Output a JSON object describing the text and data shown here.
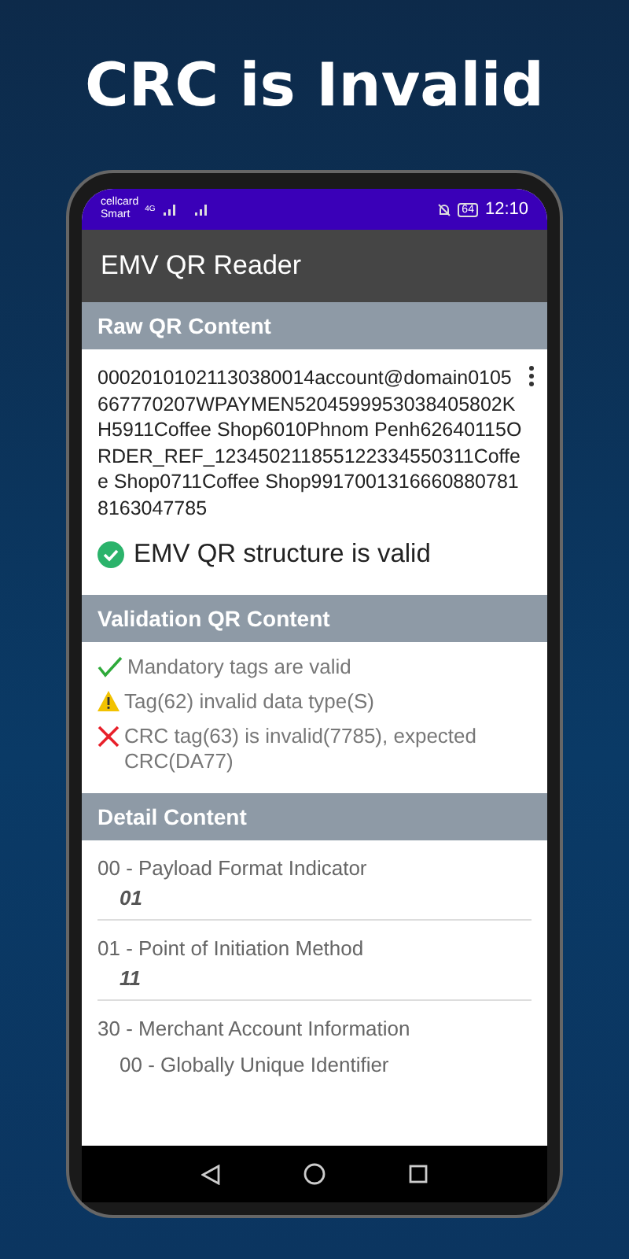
{
  "headline": "CRC is Invalid",
  "status_bar": {
    "carrier": "cellcard",
    "carrier_sub": "Smart",
    "network": "4G",
    "battery": "64",
    "time": "12:10"
  },
  "app_bar": {
    "title": "EMV QR Reader"
  },
  "raw_section": {
    "title": "Raw QR Content",
    "content": "00020101021130380014account@domain0105667770207WPAYMEN5204599953038405802KH5911Coffee Shop6010Phnom Penh62640115ORDER_REF_123450211855122334550311Coffee Shop0711Coffee Shop99170013166608807818163047785",
    "status": "EMV QR structure is valid"
  },
  "validation_section": {
    "title": "Validation QR Content",
    "items": [
      {
        "kind": "ok",
        "text": "Mandatory tags are valid"
      },
      {
        "kind": "warning",
        "text": "Tag(62) invalid data type(S)"
      },
      {
        "kind": "error",
        "text": "CRC tag(63) is invalid(7785), expected CRC(DA77)"
      }
    ]
  },
  "detail_section": {
    "title": "Detail Content",
    "items": [
      {
        "label": "00 - Payload Format Indicator",
        "value": "01"
      },
      {
        "label": "01 - Point of Initiation Method",
        "value": "11"
      },
      {
        "label": "30 - Merchant Account Information",
        "children": [
          {
            "label": "00 - Globally Unique Identifier"
          }
        ]
      }
    ]
  }
}
